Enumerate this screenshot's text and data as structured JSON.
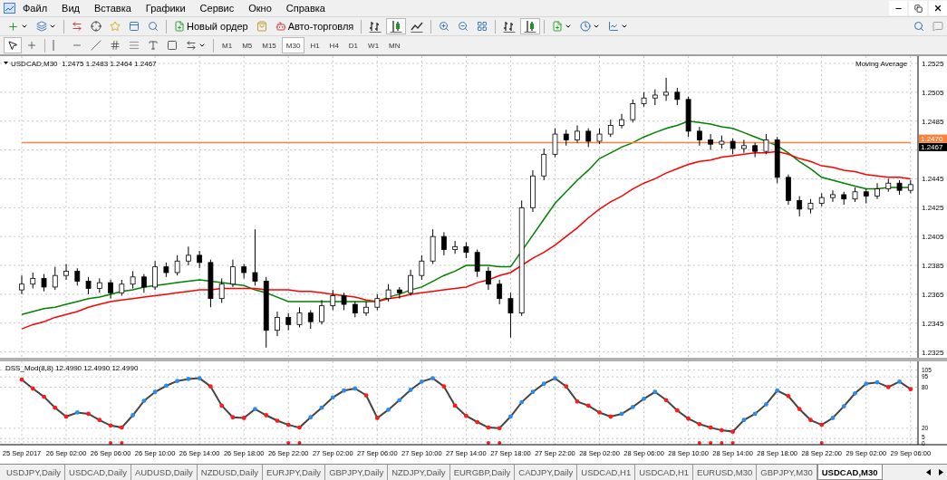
{
  "menu": [
    "Файл",
    "Вид",
    "Вставка",
    "Графики",
    "Сервис",
    "Окно",
    "Справка"
  ],
  "toolbar": {
    "new_order": "Новый ордер",
    "auto_trading": "Авто-торговля",
    "chart_modes": [
      {
        "selected": false
      },
      {
        "selected": true
      },
      {
        "selected": false
      }
    ],
    "scroll_modes": [
      {
        "selected": false
      },
      {
        "selected": true
      }
    ]
  },
  "drawing_tools": [
    {
      "selected": true
    },
    {
      "selected": false
    }
  ],
  "timeframes": [
    {
      "label": "M1",
      "selected": false
    },
    {
      "label": "M5",
      "selected": false
    },
    {
      "label": "M15",
      "selected": false
    },
    {
      "label": "M30",
      "selected": true
    },
    {
      "label": "H1",
      "selected": false
    },
    {
      "label": "H4",
      "selected": false
    },
    {
      "label": "D1",
      "selected": false
    },
    {
      "label": "W1",
      "selected": false
    },
    {
      "label": "MN",
      "selected": false
    }
  ],
  "chart": {
    "symbol": "USDCAD,M30",
    "ohlc": "1.2475 1.2483 1.2464 1.2467",
    "indicator": "Moving Average",
    "level": "1.2470",
    "bid": "1.2467",
    "chart_data": {
      "type": "candlestick",
      "grid": true,
      "categories": [
        null,
        null,
        null,
        null,
        null,
        null,
        null,
        null,
        null,
        null,
        null,
        null,
        null,
        null,
        null,
        null,
        null,
        null,
        null,
        null,
        null,
        null,
        null,
        null,
        null,
        null,
        null,
        null,
        null,
        null,
        null,
        null,
        null,
        null,
        null,
        null,
        null,
        null,
        null,
        null,
        null,
        null,
        null,
        null,
        null,
        null,
        null,
        null,
        null,
        null,
        null,
        null,
        null,
        null,
        null,
        null,
        null,
        null,
        null,
        null,
        null,
        null,
        null,
        null,
        null,
        null,
        null,
        null,
        null,
        null,
        null,
        null,
        null,
        null,
        null,
        null,
        null,
        null,
        null,
        null,
        null
      ],
      "ohlc": [
        [
          1.2368,
          1.2378,
          1.2365,
          1.2372
        ],
        [
          1.2372,
          1.238,
          1.2369,
          1.2376
        ],
        [
          1.2376,
          1.2379,
          1.2367,
          1.237
        ],
        [
          1.237,
          1.2384,
          1.2368,
          1.2378
        ],
        [
          1.2378,
          1.2386,
          1.2375,
          1.2381
        ],
        [
          1.2381,
          1.2383,
          1.2371,
          1.2374
        ],
        [
          1.2374,
          1.2377,
          1.2365,
          1.2369
        ],
        [
          1.2369,
          1.2376,
          1.2366,
          1.2373
        ],
        [
          1.2373,
          1.2375,
          1.2362,
          1.2366
        ],
        [
          1.2366,
          1.2375,
          1.2364,
          1.2372
        ],
        [
          1.2372,
          1.2381,
          1.2369,
          1.2377
        ],
        [
          1.2377,
          1.2379,
          1.2366,
          1.237
        ],
        [
          1.237,
          1.2388,
          1.2368,
          1.2384
        ],
        [
          1.2384,
          1.2387,
          1.2377,
          1.238
        ],
        [
          1.238,
          1.2392,
          1.2378,
          1.2388
        ],
        [
          1.2388,
          1.2398,
          1.2385,
          1.2392
        ],
        [
          1.2392,
          1.2395,
          1.2383,
          1.2387
        ],
        [
          1.2387,
          1.2389,
          1.2356,
          1.2362
        ],
        [
          1.2362,
          1.2376,
          1.2359,
          1.2372
        ],
        [
          1.2372,
          1.2389,
          1.237,
          1.2384
        ],
        [
          1.2384,
          1.2386,
          1.2376,
          1.238
        ],
        [
          1.238,
          1.241,
          1.2371,
          1.2374
        ],
        [
          1.2374,
          1.2377,
          1.2328,
          1.234
        ],
        [
          1.234,
          1.2353,
          1.2336,
          1.2349
        ],
        [
          1.2349,
          1.2352,
          1.234,
          1.2344
        ],
        [
          1.2344,
          1.2356,
          1.2342,
          1.2352
        ],
        [
          1.2352,
          1.2354,
          1.2341,
          1.2346
        ],
        [
          1.2346,
          1.2361,
          1.2344,
          1.2357
        ],
        [
          1.2357,
          1.2368,
          1.2354,
          1.2364
        ],
        [
          1.2364,
          1.2366,
          1.2354,
          1.2358
        ],
        [
          1.2358,
          1.236,
          1.2349,
          1.2352
        ],
        [
          1.2352,
          1.236,
          1.235,
          1.2356
        ],
        [
          1.2356,
          1.2365,
          1.2354,
          1.2362
        ],
        [
          1.2362,
          1.2372,
          1.236,
          1.2368
        ],
        [
          1.2368,
          1.237,
          1.2362,
          1.2366
        ],
        [
          1.2366,
          1.2382,
          1.2364,
          1.2378
        ],
        [
          1.2378,
          1.2392,
          1.2375,
          1.2388
        ],
        [
          1.2388,
          1.241,
          1.2386,
          1.2405
        ],
        [
          1.2405,
          1.2408,
          1.2392,
          1.2396
        ],
        [
          1.2396,
          1.2402,
          1.2393,
          1.2398
        ],
        [
          1.2398,
          1.2401,
          1.239,
          1.2394
        ],
        [
          1.2394,
          1.2396,
          1.2377,
          1.2381
        ],
        [
          1.2381,
          1.2384,
          1.2368,
          1.2372
        ],
        [
          1.2372,
          1.2375,
          1.2358,
          1.2362
        ],
        [
          1.2362,
          1.2366,
          1.2335,
          1.2352
        ],
        [
          1.2352,
          1.243,
          1.235,
          1.2425
        ],
        [
          1.2425,
          1.2451,
          1.2422,
          1.2447
        ],
        [
          1.2447,
          1.2466,
          1.2444,
          1.2462
        ],
        [
          1.2462,
          1.248,
          1.246,
          1.2476
        ],
        [
          1.2476,
          1.2479,
          1.2468,
          1.2472
        ],
        [
          1.2472,
          1.2482,
          1.247,
          1.2478
        ],
        [
          1.2478,
          1.248,
          1.2467,
          1.2471
        ],
        [
          1.2471,
          1.248,
          1.2469,
          1.2476
        ],
        [
          1.2476,
          1.2486,
          1.2474,
          1.2482
        ],
        [
          1.2482,
          1.249,
          1.248,
          1.2486
        ],
        [
          1.2486,
          1.25,
          1.2484,
          1.2497
        ],
        [
          1.2497,
          1.2505,
          1.2495,
          1.2501
        ],
        [
          1.2501,
          1.2507,
          1.2496,
          1.2503
        ],
        [
          1.2503,
          1.2515,
          1.2499,
          1.2505
        ],
        [
          1.2505,
          1.2508,
          1.2496,
          1.25
        ],
        [
          1.25,
          1.2502,
          1.2474,
          1.2478
        ],
        [
          1.2478,
          1.2481,
          1.2468,
          1.2472
        ],
        [
          1.2472,
          1.2476,
          1.2465,
          1.2469
        ],
        [
          1.2469,
          1.2475,
          1.2466,
          1.2471
        ],
        [
          1.2471,
          1.2473,
          1.2462,
          1.2466
        ],
        [
          1.2466,
          1.2472,
          1.2463,
          1.2468
        ],
        [
          1.2468,
          1.247,
          1.246,
          1.2464
        ],
        [
          1.2464,
          1.2476,
          1.2462,
          1.2472
        ],
        [
          1.2472,
          1.2474,
          1.2442,
          1.2446
        ],
        [
          1.2446,
          1.2448,
          1.2427,
          1.243
        ],
        [
          1.243,
          1.2433,
          1.2419,
          1.2424
        ],
        [
          1.2424,
          1.2431,
          1.2421,
          1.2428
        ],
        [
          1.2428,
          1.2435,
          1.2426,
          1.2432
        ],
        [
          1.2432,
          1.2437,
          1.2429,
          1.2434
        ],
        [
          1.2434,
          1.2436,
          1.2427,
          1.2431
        ],
        [
          1.2431,
          1.2439,
          1.2429,
          1.2436
        ],
        [
          1.2436,
          1.2438,
          1.2428,
          1.2433
        ],
        [
          1.2433,
          1.2442,
          1.2431,
          1.2438
        ],
        [
          1.2438,
          1.2445,
          1.2436,
          1.2442
        ],
        [
          1.2442,
          1.2444,
          1.2434,
          1.2437
        ],
        [
          1.2437,
          1.2444,
          1.2435,
          1.2441
        ]
      ],
      "series": [
        {
          "type": "line",
          "color": "#008000",
          "values": [
            1.2351,
            1.2353,
            1.2355,
            1.2356,
            1.2358,
            1.236,
            1.2362,
            1.2363,
            1.2365,
            1.2367,
            1.2368,
            1.237,
            1.2371,
            1.2372,
            1.2373,
            1.2374,
            1.2375,
            1.2374,
            1.2373,
            1.2372,
            1.2371,
            1.2368,
            1.2366,
            1.2363,
            1.236,
            1.236,
            1.236,
            1.236,
            1.236,
            1.236,
            1.236,
            1.236,
            1.236,
            1.2363,
            1.2365,
            1.2368,
            1.237,
            1.2374,
            1.2378,
            1.2381,
            1.2385,
            1.2385,
            1.2385,
            1.2384,
            1.2384,
            1.2395,
            1.2406,
            1.2417,
            1.2428,
            1.2436,
            1.2444,
            1.2451,
            1.2459,
            1.2463,
            1.2467,
            1.247,
            1.2474,
            1.2477,
            1.248,
            1.2482,
            1.2485,
            1.2484,
            1.2483,
            1.2481,
            1.248,
            1.2477,
            1.2474,
            1.2471,
            1.2468,
            1.2463,
            1.2457,
            1.2452,
            1.2446,
            1.2444,
            1.2442,
            1.244,
            1.2438,
            1.2438,
            1.2439,
            1.2439,
            1.2439
          ]
        },
        {
          "type": "line",
          "color": "#ff0000",
          "values": [
            1.2341,
            1.2344,
            1.2346,
            1.2349,
            1.2351,
            1.2353,
            1.2356,
            1.2358,
            1.236,
            1.2361,
            1.2362,
            1.2363,
            1.2364,
            1.2365,
            1.2366,
            1.2367,
            1.2368,
            1.2368,
            1.2369,
            1.2369,
            1.2369,
            1.2369,
            1.2368,
            1.2368,
            1.2368,
            1.2367,
            1.2367,
            1.2366,
            1.2365,
            1.2364,
            1.2363,
            1.2361,
            1.236,
            1.2362,
            1.2363,
            1.2365,
            1.2366,
            1.2367,
            1.2368,
            1.2369,
            1.237,
            1.2373,
            1.2375,
            1.2378,
            1.238,
            1.2385,
            1.239,
            1.2394,
            1.2399,
            1.2405,
            1.2411,
            1.2418,
            1.2424,
            1.2429,
            1.2433,
            1.2438,
            1.2442,
            1.2445,
            1.2449,
            1.2452,
            1.2455,
            1.2457,
            1.2458,
            1.246,
            1.2461,
            1.2462,
            1.2463,
            1.2463,
            1.2464,
            1.2462,
            1.2459,
            1.2457,
            1.2454,
            1.2453,
            1.2451,
            1.245,
            1.2448,
            1.2447,
            1.2446,
            1.2446,
            1.2445
          ]
        },
        {
          "type": "line",
          "color": "#ff7f3f",
          "values": [
            1.247,
            1.247,
            1.247,
            1.247,
            1.247,
            1.247,
            1.247,
            1.247,
            1.247,
            1.247,
            1.247,
            1.247,
            1.247,
            1.247,
            1.247,
            1.247,
            1.247,
            1.247,
            1.247,
            1.247,
            1.247,
            1.247,
            1.247,
            1.247,
            1.247,
            1.247,
            1.247,
            1.247,
            1.247,
            1.247,
            1.247,
            1.247,
            1.247,
            1.247,
            1.247,
            1.247,
            1.247,
            1.247,
            1.247,
            1.247,
            1.247,
            1.247,
            1.247,
            1.247,
            1.247,
            1.247,
            1.247,
            1.247,
            1.247,
            1.247,
            1.247,
            1.247,
            1.247,
            1.247,
            1.247,
            1.247,
            1.247,
            1.247,
            1.247,
            1.247,
            1.247,
            1.247,
            1.247,
            1.247,
            1.247,
            1.247,
            1.247,
            1.247,
            1.247,
            1.247,
            1.247,
            1.247,
            1.247,
            1.247,
            1.247,
            1.247,
            1.247,
            1.247,
            1.247,
            1.247,
            1.247
          ]
        }
      ],
      "yticks": [
        1.2525,
        1.2505,
        1.2485,
        1.2445,
        1.2425,
        1.2405,
        1.2385,
        1.2365,
        1.2345,
        1.2325
      ],
      "ylim": [
        1.2321,
        1.2529
      ]
    },
    "oscillator": {
      "chart_data": {
        "type": "line",
        "grid": true,
        "title": "DSS_Mod(8,8) 12.4990 12.4990 12.4990",
        "categories": [
          "25 Sep 2017",
          null,
          null,
          null,
          "26 Sep 02:00",
          null,
          null,
          null,
          "26 Sep 06:00",
          null,
          null,
          null,
          "26 Sep 10:00",
          null,
          null,
          null,
          "26 Sep 14:00",
          null,
          null,
          null,
          "26 Sep 18:00",
          null,
          null,
          null,
          "26 Sep 22:00",
          null,
          null,
          null,
          "27 Sep 02:00",
          null,
          null,
          null,
          "27 Sep 06:00",
          null,
          null,
          null,
          "27 Sep 10:00",
          null,
          null,
          null,
          "27 Sep 14:00",
          null,
          null,
          null,
          "27 Sep 18:00",
          null,
          null,
          null,
          "27 Sep 22:00",
          null,
          null,
          null,
          "28 Sep 02:00",
          null,
          null,
          null,
          "28 Sep 06:00",
          null,
          null,
          null,
          "28 Sep 10:00",
          null,
          null,
          null,
          "28 Sep 14:00",
          null,
          null,
          null,
          "28 Sep 18:00",
          null,
          null,
          null,
          "28 Sep 22:00",
          null,
          null,
          null,
          "29 Sep 02:00",
          null,
          null,
          null,
          "29 Sep 06:00"
        ],
        "yticks": [
          105,
          95,
          80,
          20,
          5,
          0
        ],
        "ylim": [
          -4,
          115
        ],
        "series": [
          {
            "color": "#444444",
            "values": [
              91,
              78,
              66,
              50,
              37,
              43,
              41,
              32,
              24,
              21,
              39,
              60,
              73,
              82,
              89,
              92,
              93,
              81,
              53,
              36,
              35,
              48,
              39,
              31,
              25,
              21,
              36,
              50,
              65,
              75,
              78,
              68,
              35,
              47,
              61,
              76,
              88,
              93,
              81,
              53,
              38,
              29,
              21,
              20,
              37,
              58,
              73,
              85,
              93,
              81,
              59,
              53,
              43,
              37,
              41,
              51,
              63,
              73,
              61,
              46,
              34,
              26,
              21,
              17,
              15,
              32,
              41,
              55,
              75,
              67,
              48,
              32,
              25,
              35,
              52,
              71,
              85,
              87,
              80,
              88,
              77
            ]
          }
        ]
      }
    }
  },
  "tabs": [
    {
      "label": "USDJPY,Daily",
      "selected": false
    },
    {
      "label": "USDCAD,Daily",
      "selected": false
    },
    {
      "label": "AUDUSD,Daily",
      "selected": false
    },
    {
      "label": "NZDUSD,Daily",
      "selected": false
    },
    {
      "label": "EURJPY,Daily",
      "selected": false
    },
    {
      "label": "GBPJPY,Daily",
      "selected": false
    },
    {
      "label": "NZDJPY,Daily",
      "selected": false
    },
    {
      "label": "EURGBP,Daily",
      "selected": false
    },
    {
      "label": "CADJPY,Daily",
      "selected": false
    },
    {
      "label": "USDCAD,H1",
      "selected": false
    },
    {
      "label": "USDCAD,H1",
      "selected": false
    },
    {
      "label": "EURUSD,M30",
      "selected": false
    },
    {
      "label": "GBPJPY,M30",
      "selected": false
    },
    {
      "label": "USDCAD,M30",
      "selected": true
    }
  ]
}
